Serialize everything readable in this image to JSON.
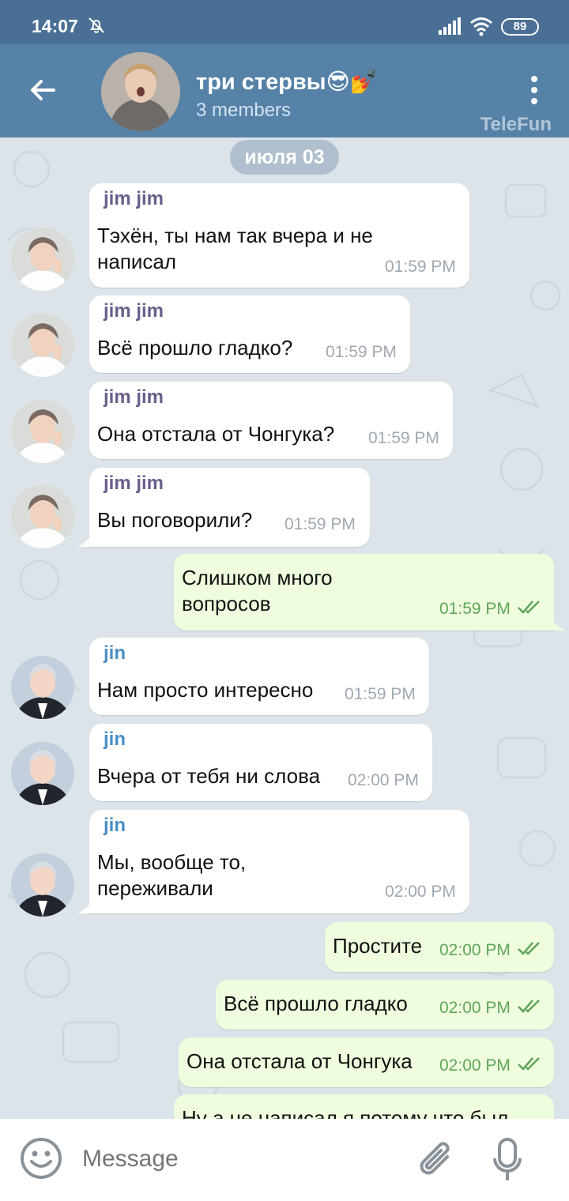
{
  "status_bar": {
    "time": "14:07",
    "battery": "89",
    "icons": [
      "bell-off-icon",
      "signal-icon",
      "wifi-icon",
      "battery-icon"
    ]
  },
  "header": {
    "title": "три стервы😎💅",
    "subtitle": "3 members",
    "watermark": "TeleFun",
    "back_icon": "arrow-left-icon",
    "menu_icon": "more-vertical-icon"
  },
  "chat": {
    "date": "июля 03",
    "messages": [
      {
        "sender": "jim jim",
        "lines": [
          "Тэхён, ты нам так вчера и не",
          "написал"
        ],
        "time": "01:59 PM",
        "direction": "in"
      },
      {
        "sender": "jim jim",
        "lines": [
          "Всё прошло гладко?"
        ],
        "time": "01:59 PM",
        "direction": "in"
      },
      {
        "sender": "jim jim",
        "lines": [
          "Она отстала от Чонгука?"
        ],
        "time": "01:59 PM",
        "direction": "in"
      },
      {
        "sender": "jim jim",
        "lines": [
          "Вы поговорили?"
        ],
        "time": "01:59 PM",
        "direction": "in"
      },
      {
        "sender": "",
        "lines": [
          "Слишком много",
          "вопросов"
        ],
        "time": "01:59 PM",
        "direction": "out"
      },
      {
        "sender": "jin",
        "lines": [
          "Нам просто интересно"
        ],
        "time": "01:59 PM",
        "direction": "in"
      },
      {
        "sender": "jin",
        "lines": [
          "Вчера от тебя ни слова"
        ],
        "time": "02:00 PM",
        "direction": "in"
      },
      {
        "sender": "jin",
        "lines": [
          "Мы, вообще то,",
          "переживали"
        ],
        "time": "02:00 PM",
        "direction": "in"
      },
      {
        "sender": "",
        "lines": [
          "Простите"
        ],
        "time": "02:00 PM",
        "direction": "out"
      },
      {
        "sender": "",
        "lines": [
          "Всё прошло гладко"
        ],
        "time": "02:00 PM",
        "direction": "out"
      },
      {
        "sender": "",
        "lines": [
          "Она отстала от Чонгука"
        ],
        "time": "02:00 PM",
        "direction": "out"
      },
      {
        "sender": "",
        "lines": [
          "Ну а не написал я потому что был"
        ],
        "time": "",
        "direction": "out"
      }
    ]
  },
  "input": {
    "placeholder": "Message",
    "emoji_icon": "emoji-icon",
    "attach_icon": "paperclip-icon",
    "mic_icon": "microphone-icon"
  },
  "colors": {
    "status_bar": "#4a6f95",
    "header": "#5682a8",
    "chat_bg": "#dce4ea",
    "incoming_bubble": "#ffffff",
    "outgoing_bubble": "#effdde",
    "jim_name": "#6b5e8c",
    "jin_name": "#4a8fc7",
    "out_time": "#5fa65a"
  }
}
